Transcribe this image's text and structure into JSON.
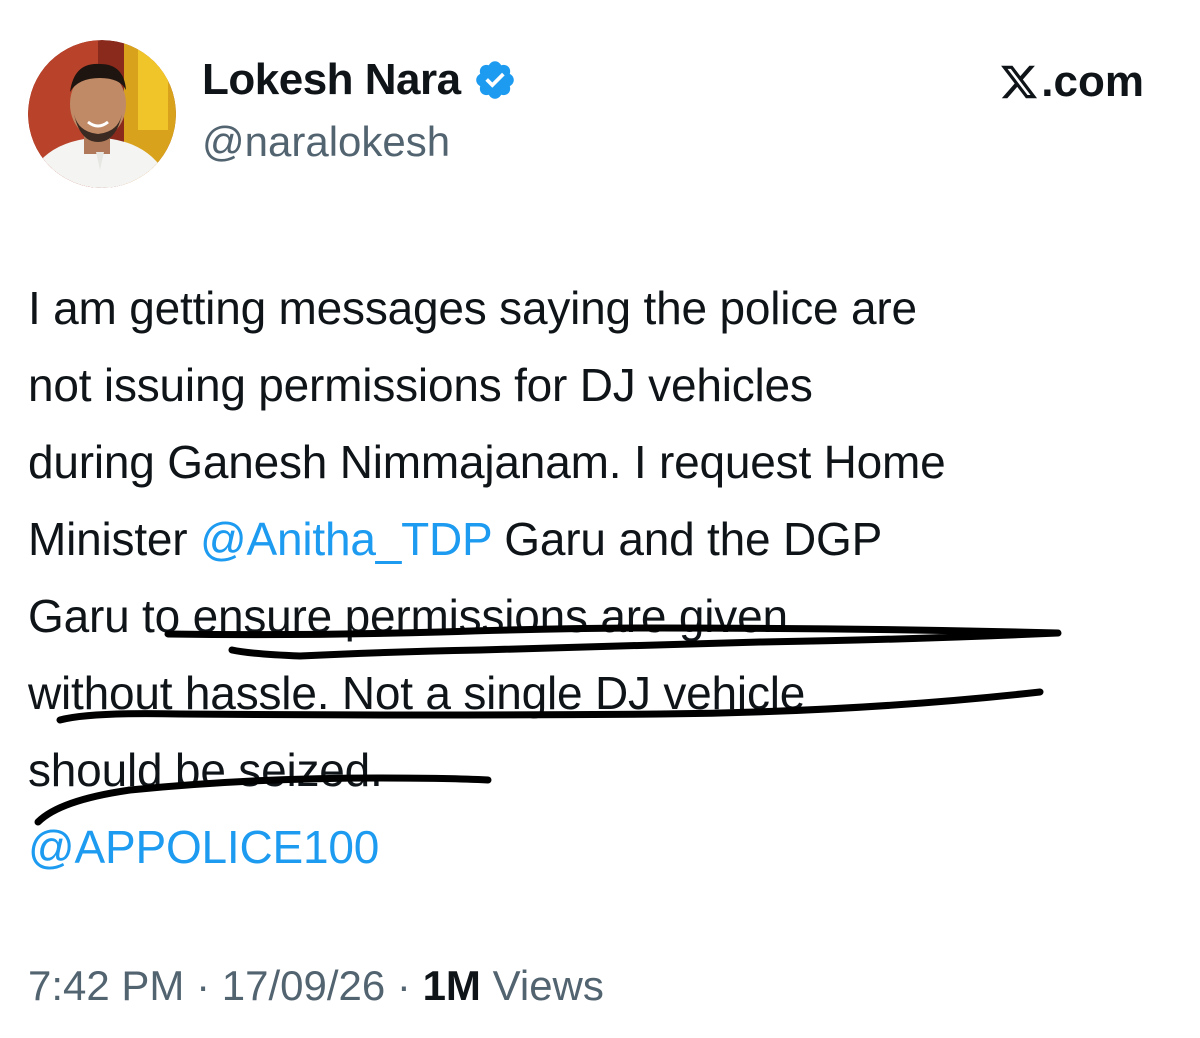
{
  "author": {
    "display_name": "Lokesh Nara",
    "handle": "@naralokesh",
    "verified_icon": "verified-badge-icon",
    "avatar_icon": "profile-photo"
  },
  "brand": {
    "label": ".com",
    "logo_icon": "x-logo-icon"
  },
  "tweet": {
    "lines": [
      [
        {
          "text": "I am getting messages saying the police are"
        }
      ],
      [
        {
          "text": "not issuing permissions for DJ vehicles"
        }
      ],
      [
        {
          "text": "during Ganesh Nimmajanam. I request Home"
        }
      ],
      [
        {
          "text": "Minister "
        },
        {
          "text": "@Anitha_TDP",
          "mention": true
        },
        {
          "text": " Garu and the DGP"
        }
      ],
      [
        {
          "text": "Garu to ensure permissions are given"
        }
      ],
      [
        {
          "text": "without hassle. Not a single DJ vehicle"
        }
      ],
      [
        {
          "text": "should be seized."
        }
      ],
      [
        {
          "text": "@APPOLICE100",
          "mention": true
        }
      ]
    ]
  },
  "meta": {
    "time": "7:42 PM",
    "separator": " · ",
    "date": "17/09/26",
    "views_count": "1M",
    "views_label": "Views"
  },
  "colors": {
    "text": "#0f1419",
    "secondary": "#536471",
    "mention": "#1d9bf0",
    "verified": "#1d9bf0",
    "scribble": "#000000"
  }
}
